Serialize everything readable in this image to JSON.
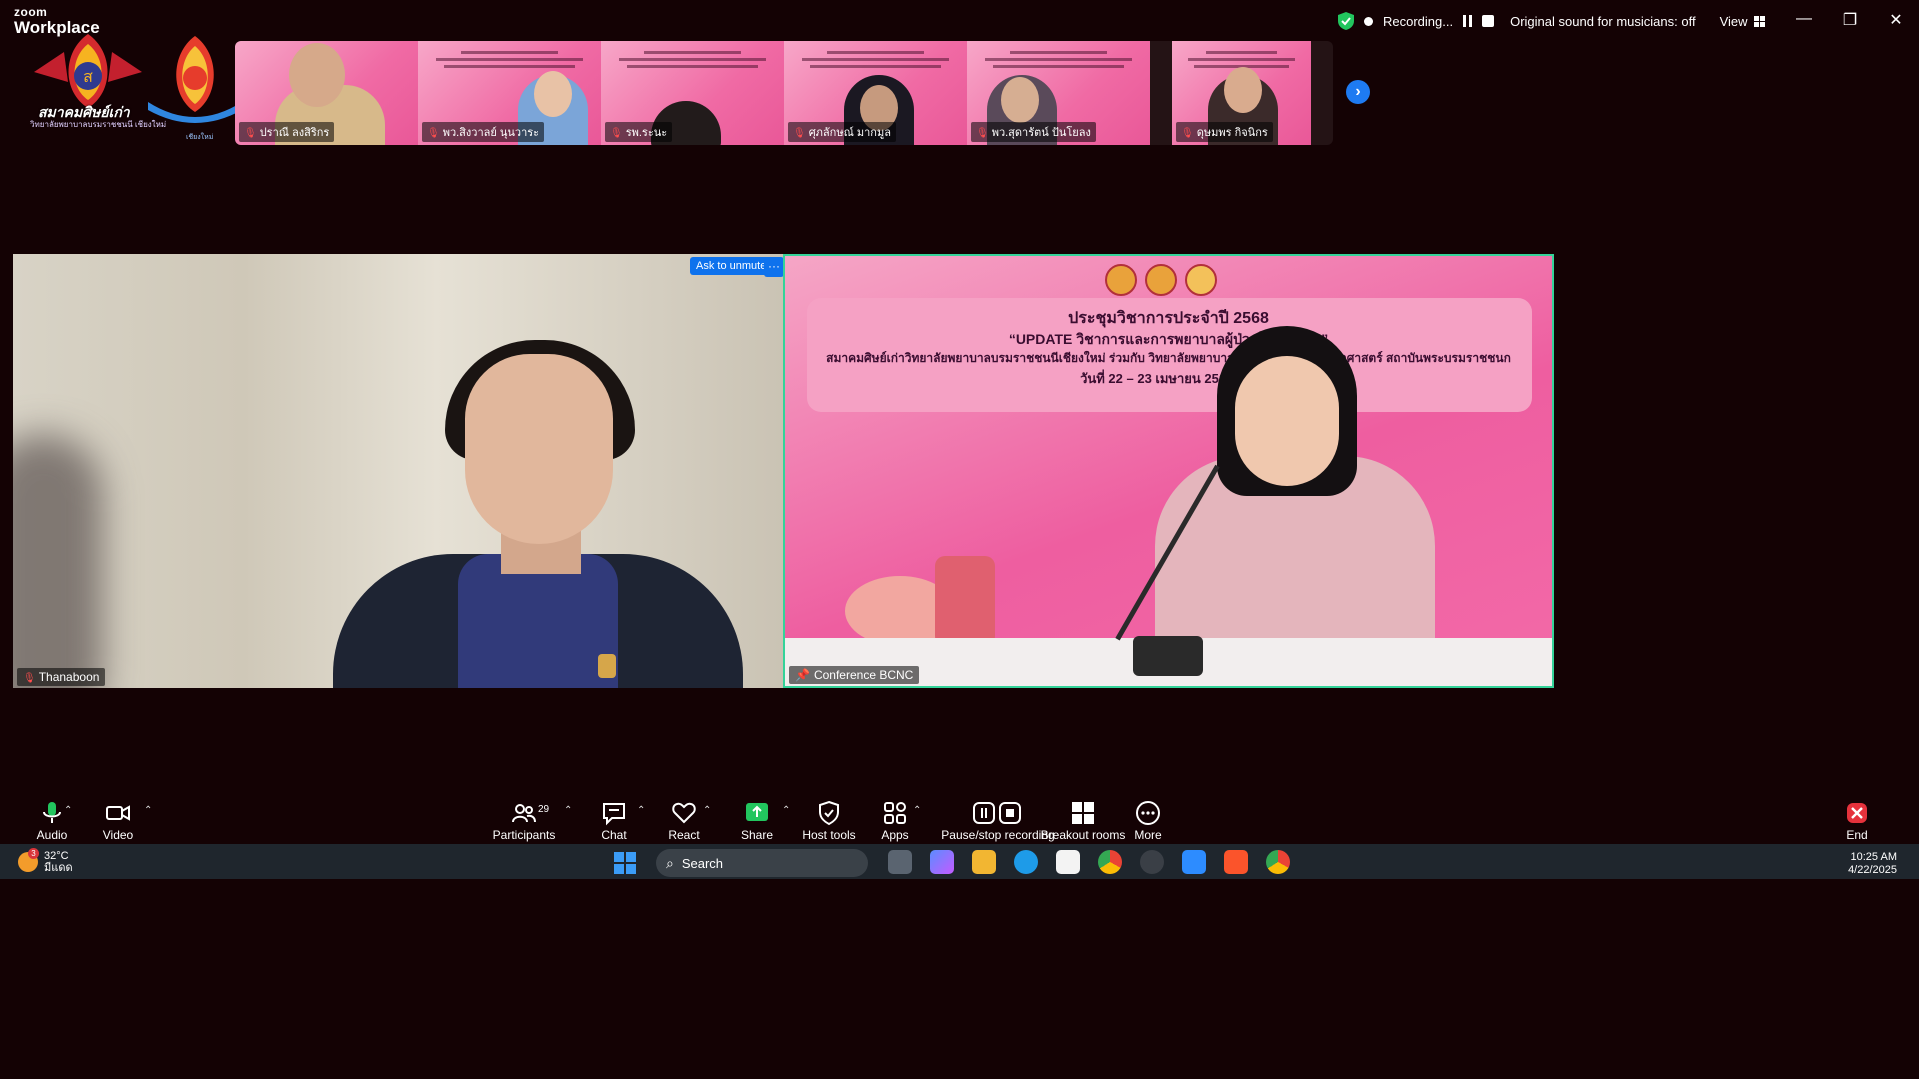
{
  "app": {
    "brand_small": "zoom",
    "brand_large": "Workplace"
  },
  "recording": {
    "status": "Recording...",
    "sound": "Original sound for musicians: off",
    "view": "View"
  },
  "logos": {
    "caption1": "สมาคมศิษย์เก่า",
    "caption2": "วิทยาลัยพยาบาลบรมราชชนนี เชียงใหม่",
    "caption3": "เชียงใหม่"
  },
  "thumbnails": [
    {
      "name": "ปราณี ลงสิริกร"
    },
    {
      "name": "พว.สิงวาลย์ นุนวาระ"
    },
    {
      "name": "รพ.ระนะ"
    },
    {
      "name": "ศุภลักษณ์ มากมูล"
    },
    {
      "name": "พว.สุดารัตน์ ปันโยลง"
    },
    {
      "name": "ดุษมพร กิจนิกร"
    }
  ],
  "videos": {
    "left": {
      "name": "Thanaboon",
      "ask_unmute": "Ask to unmute",
      "more": "···"
    },
    "right": {
      "name": "Conference BCNC",
      "slide_title": "ประชุมวิชาการประจำปี 2568",
      "slide_subtitle": "“UPDATE วิชาการและการพยาบาลผู้ป่วยโรค…                   …ง”",
      "slide_line3": "สมาคมศิษย์เก่าวิทยาลัยพยาบาลบรมราชชนนีเชียงใหม่ ร่วมกับ วิทยาลัยพยาบาลบรมรา…          …ะพยาบาลศาสตร์ สถาบันพระบรมราชชนก",
      "slide_line4": "วันที่  22 – 23 เมษายน 2568 รู…"
    }
  },
  "toolbar": {
    "audio": "Audio",
    "video": "Video",
    "participants": "Participants",
    "participants_count": "29",
    "chat": "Chat",
    "react": "React",
    "share": "Share",
    "host_tools": "Host tools",
    "apps": "Apps",
    "recording": "Pause/stop recording",
    "breakout": "Breakout rooms",
    "more": "More",
    "end": "End"
  },
  "taskbar": {
    "temp": "32°C",
    "weather": "มีแดด",
    "weather_badge": "3",
    "search": "Search",
    "time": "10:25 AM",
    "date": "4/22/2025"
  },
  "colors": {
    "accent": "#0e72ed",
    "active_speaker": "#34d399",
    "share_green": "#22c55e",
    "end_red": "#e5323c"
  }
}
